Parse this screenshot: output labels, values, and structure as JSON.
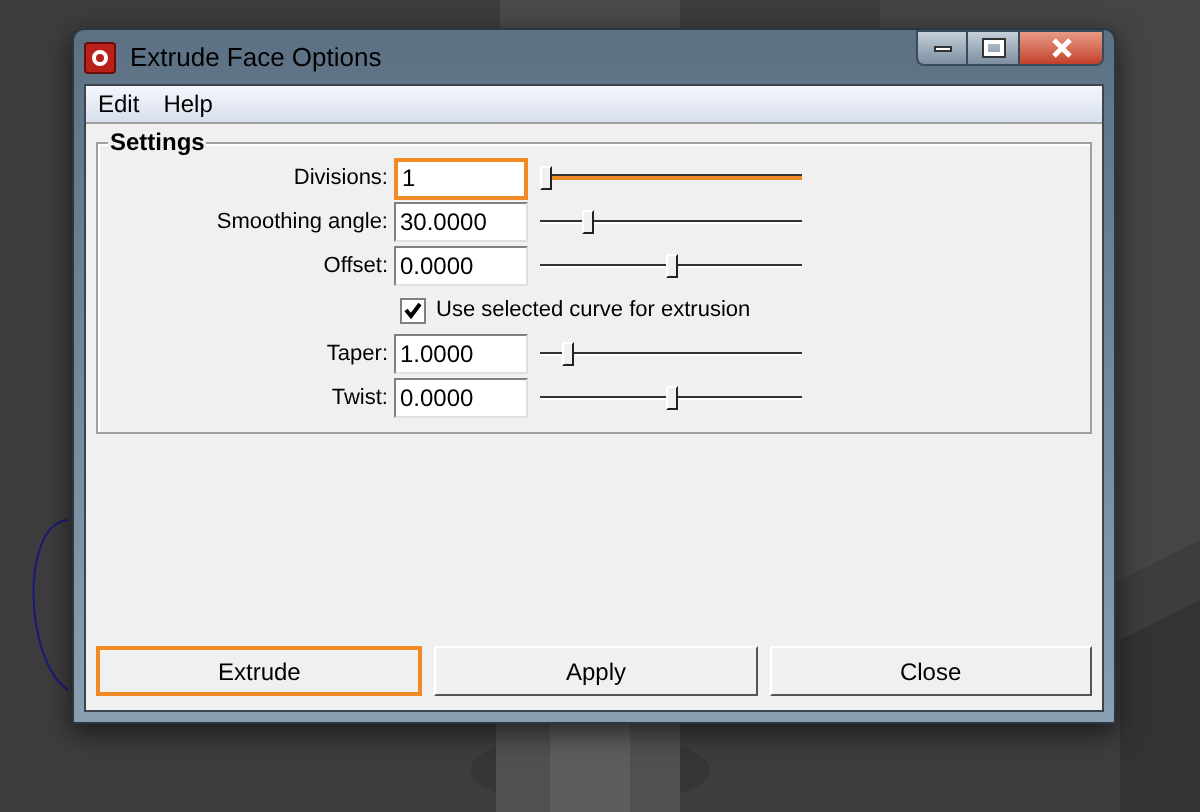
{
  "window": {
    "title": "Extrude Face Options"
  },
  "menu": [
    "Edit",
    "Help"
  ],
  "settings": {
    "title": "Settings",
    "rows": [
      {
        "kind": "slider",
        "label": "Divisions:",
        "value": "1",
        "level": 0,
        "focused": true
      },
      {
        "kind": "slider",
        "label": "Smoothing angle:",
        "value": "30.0000",
        "level": 0.17,
        "focused": false
      },
      {
        "kind": "slider",
        "label": "Offset:",
        "value": "0.0000",
        "level": 0.5,
        "focused": false
      },
      {
        "kind": "checkbox",
        "label": "Use selected curve for extrusion",
        "checked": true
      },
      {
        "kind": "slider",
        "label": "Taper:",
        "value": "1.0000",
        "level": 0.09,
        "focused": false
      },
      {
        "kind": "slider",
        "label": "Twist:",
        "value": "0.0000",
        "level": 0.5,
        "focused": false
      }
    ]
  },
  "buttons": [
    {
      "label": "Extrude",
      "focused": true
    },
    {
      "label": "Apply",
      "focused": false
    },
    {
      "label": "Close",
      "focused": false
    }
  ]
}
